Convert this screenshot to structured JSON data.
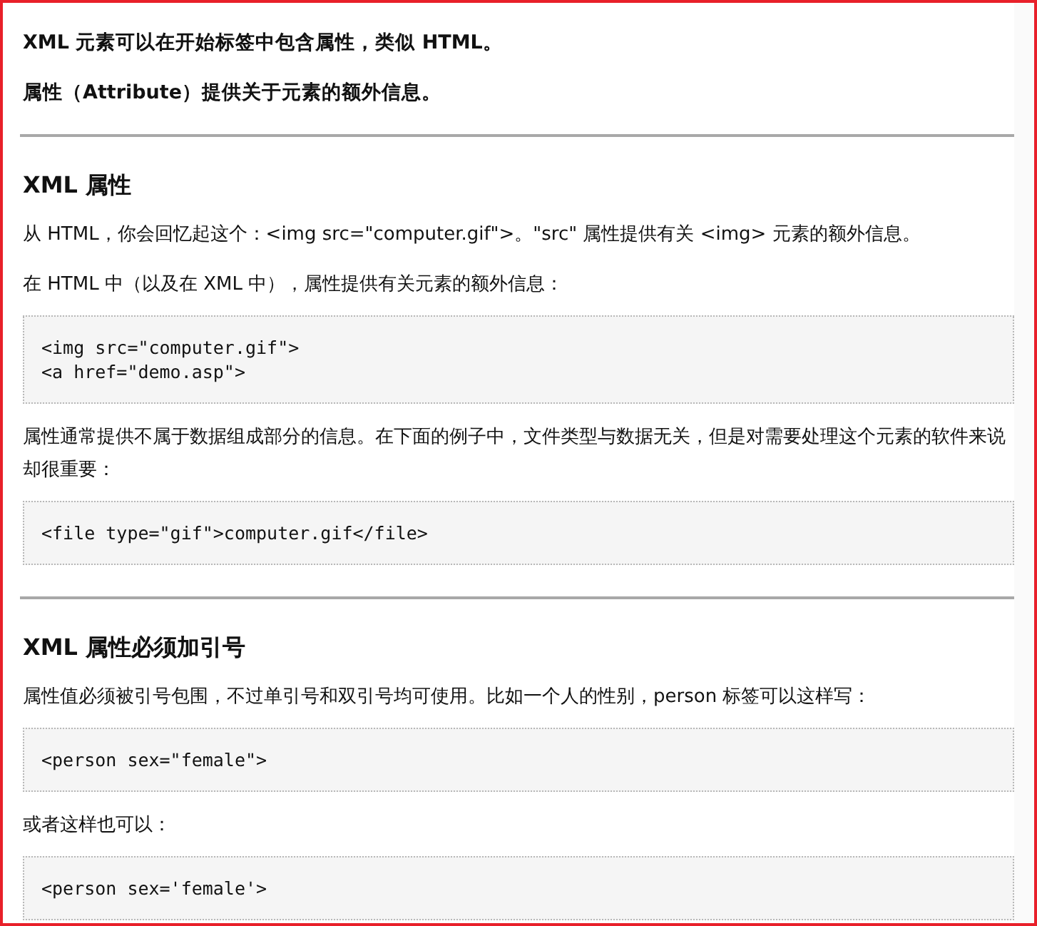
{
  "blocks": [
    {
      "kind": "lead",
      "text": "XML 元素可以在开始标签中包含属性，类似 HTML。"
    },
    {
      "kind": "lead",
      "text": "属性（Attribute）提供关于元素的额外信息。"
    },
    {
      "kind": "rule"
    },
    {
      "kind": "heading",
      "text": "XML 属性"
    },
    {
      "kind": "para",
      "text": "从 HTML，你会回忆起这个：<img src=\"computer.gif\">。\"src\" 属性提供有关 <img> 元素的额外信息。"
    },
    {
      "kind": "para",
      "text": "在 HTML 中（以及在 XML 中），属性提供有关元素的额外信息："
    },
    {
      "kind": "code",
      "lines": [
        "<img src=\"computer.gif\">",
        "<a href=\"demo.asp\">"
      ]
    },
    {
      "kind": "para",
      "text": "属性通常提供不属于数据组成部分的信息。在下面的例子中，文件类型与数据无关，但是对需要处理这个元素的软件来说却很重要："
    },
    {
      "kind": "code",
      "lines": [
        "<file type=\"gif\">computer.gif</file>"
      ]
    },
    {
      "kind": "rule"
    },
    {
      "kind": "heading",
      "text": "XML 属性必须加引号"
    },
    {
      "kind": "para",
      "text": "属性值必须被引号包围，不过单引号和双引号均可使用。比如一个人的性别，person 标签可以这样写："
    },
    {
      "kind": "code",
      "lines": [
        "<person sex=\"female\">"
      ]
    },
    {
      "kind": "para",
      "text": "或者这样也可以："
    },
    {
      "kind": "code",
      "lines": [
        "<person sex='female'>"
      ]
    }
  ]
}
